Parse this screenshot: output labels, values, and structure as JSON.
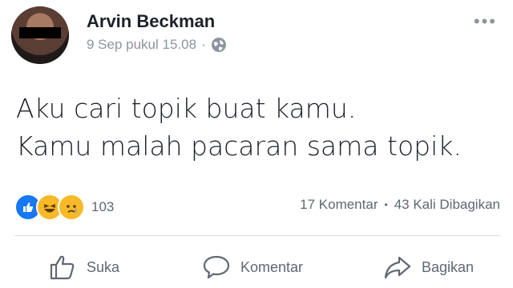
{
  "post": {
    "author": "Arvin Beckman",
    "timestamp": "9 Sep pukul 15.08",
    "separator": "·",
    "privacy_icon": "globe-icon",
    "more_icon": "more-options-icon",
    "text_lines": [
      "Aku cari topik buat kamu.",
      "Kamu malah pacaran sama topik."
    ]
  },
  "stats": {
    "reaction_icons": [
      "like-reaction-icon",
      "haha-reaction-icon",
      "sad-reaction-icon"
    ],
    "reaction_count": "103",
    "comments": "17 Komentar",
    "separator": "•",
    "shares": "43 Kali Dibagikan"
  },
  "actions": {
    "like_label": "Suka",
    "comment_label": "Komentar",
    "share_label": "Bagikan"
  },
  "colors": {
    "name": "#1d2129",
    "meta": "#8d949e",
    "like_blue": "#1877f2",
    "reaction_yellow": "#f7b928",
    "divider": "#dadde1"
  }
}
